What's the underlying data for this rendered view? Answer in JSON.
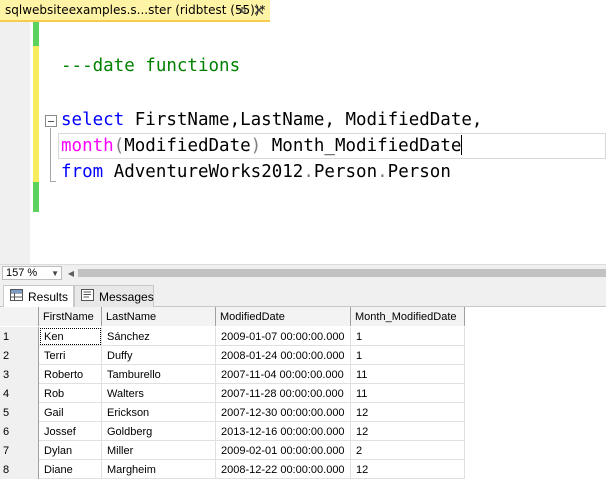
{
  "tab": {
    "title": "sqlwebsiteexamples.s...ster (ridbtest (55))*",
    "pin_icon": "pin-icon",
    "close_icon": "close-icon"
  },
  "editor": {
    "line1": {
      "comment": "---date functions"
    },
    "line2": {
      "kw": "select",
      "rest": " FirstName,LastName, ModifiedDate,"
    },
    "line3": {
      "fn": "month",
      "paren_open": "(",
      "arg": "ModifiedDate",
      "paren_close": ")",
      "alias": " Month_ModifiedDate"
    },
    "line4": {
      "kw": "from",
      "db": " AdventureWorks2012",
      "dot1": ".",
      "schema": "Person",
      "dot2": ".",
      "table": "Person"
    }
  },
  "zoom": {
    "value": "157 %"
  },
  "results_tabs": [
    {
      "label": "Results",
      "icon": "grid-icon"
    },
    {
      "label": "Messages",
      "icon": "messages-icon"
    }
  ],
  "grid": {
    "columns": [
      "",
      "FirstName",
      "LastName",
      "ModifiedDate",
      "Month_ModifiedDate"
    ],
    "rows": [
      [
        "1",
        "Ken",
        "Sánchez",
        "2009-01-07 00:00:00.000",
        "1"
      ],
      [
        "2",
        "Terri",
        "Duffy",
        "2008-01-24 00:00:00.000",
        "1"
      ],
      [
        "3",
        "Roberto",
        "Tamburello",
        "2007-11-04 00:00:00.000",
        "11"
      ],
      [
        "4",
        "Rob",
        "Walters",
        "2007-11-28 00:00:00.000",
        "11"
      ],
      [
        "5",
        "Gail",
        "Erickson",
        "2007-12-30 00:00:00.000",
        "12"
      ],
      [
        "6",
        "Jossef",
        "Goldberg",
        "2013-12-16 00:00:00.000",
        "12"
      ],
      [
        "7",
        "Dylan",
        "Miller",
        "2009-02-01 00:00:00.000",
        "2"
      ],
      [
        "8",
        "Diane",
        "Margheim",
        "2008-12-22 00:00:00.000",
        "12"
      ]
    ]
  },
  "colors": {
    "tab_bg": "#fff3a5",
    "keyword": "#0000ff",
    "function": "#ff00ff",
    "comment": "#008000",
    "change_saved": "#5ed25e",
    "change_unsaved": "#f7ec5e"
  }
}
